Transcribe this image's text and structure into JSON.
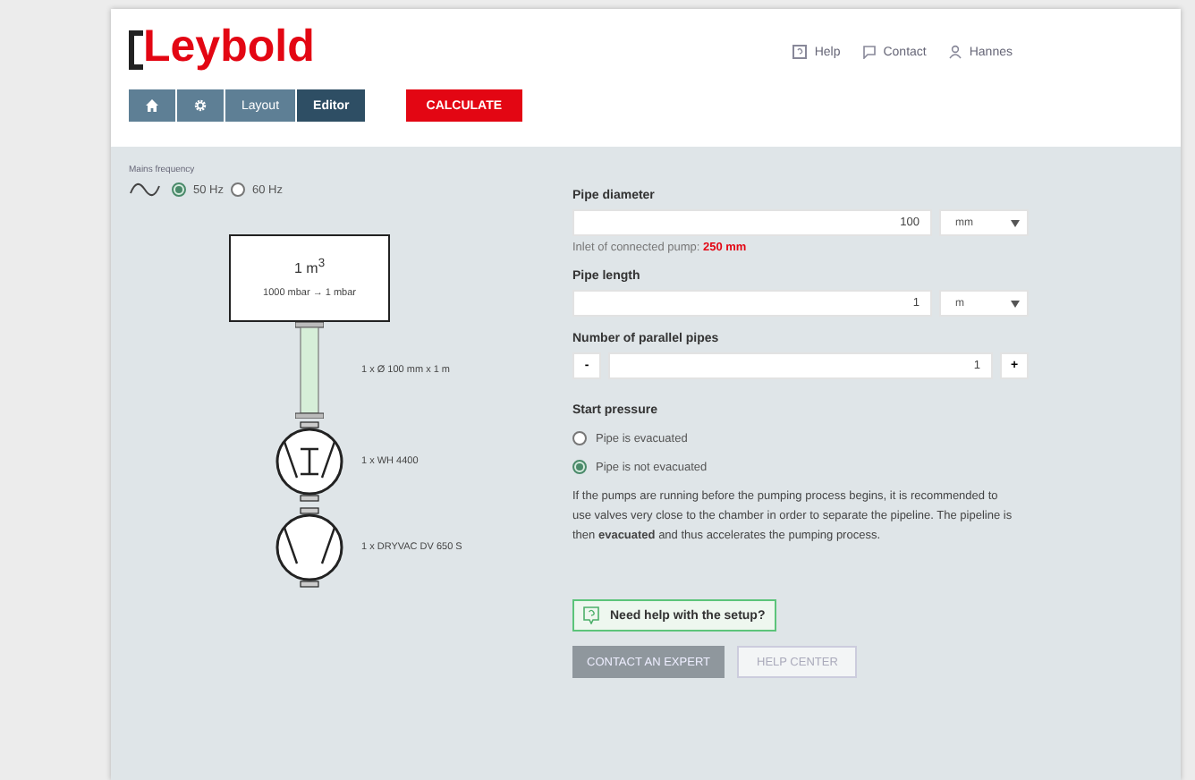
{
  "header": {
    "logo": "Leybold",
    "links": [
      {
        "kind": "help",
        "label": "Help"
      },
      {
        "kind": "contact",
        "label": "Contact"
      },
      {
        "kind": "user",
        "label": "Hannes"
      }
    ]
  },
  "breadcrumb": [
    {
      "kind": "home",
      "selected": false
    },
    {
      "kind": "settings",
      "selected": false
    },
    {
      "kind": "text",
      "label": "Layout",
      "selected": false
    },
    {
      "kind": "text",
      "label": "Editor",
      "selected": true
    }
  ],
  "calculate_button": "CALCULATE",
  "mains_frequency": {
    "label": "Mains frequency",
    "options": [
      {
        "label": "50 Hz",
        "selected": true
      },
      {
        "label": "60 Hz",
        "selected": false
      }
    ]
  },
  "diagram": {
    "chamber": {
      "volume": "1 m$^{3}$",
      "pressure": "1000 mbar → 1 mbar"
    },
    "pipe_label": "1 x Ø 100 mm x 1 m",
    "pumps": [
      {
        "kind": "roots",
        "label": "1 x WH 4400"
      },
      {
        "kind": "screw",
        "label": "1 x DRYVAC DV 650 S"
      }
    ]
  },
  "pipe_diameter": {
    "label": "Pipe diameter",
    "value": "100",
    "unit": "mm",
    "hint": "Inlet of connected pump: **250 mm**"
  },
  "pipe_length": {
    "label": "Pipe length",
    "value": "1",
    "unit": "m"
  },
  "parallel_pipes": {
    "label": "Number of parallel pipes",
    "value": "1",
    "decrement": "-",
    "increment": "+"
  },
  "start_pressure": {
    "label": "Start pressure",
    "options": [
      {
        "label": "Pipe is evacuated",
        "selected": false
      },
      {
        "label": "Pipe is not evacuated",
        "selected": true
      }
    ],
    "note": "If the pumps are running before the pumping process begins, it is recommended to use valves very close to the chamber in order to separate the pipeline. The pipeline is then **evacuated** and thus accelerates the pumping process."
  },
  "help_prompt": "Need help with the setup?",
  "buttons": [
    {
      "kind": "primary",
      "label": "CONTACT AN EXPERT"
    },
    {
      "kind": "secondary",
      "label": "HELP CENTER"
    }
  ]
}
